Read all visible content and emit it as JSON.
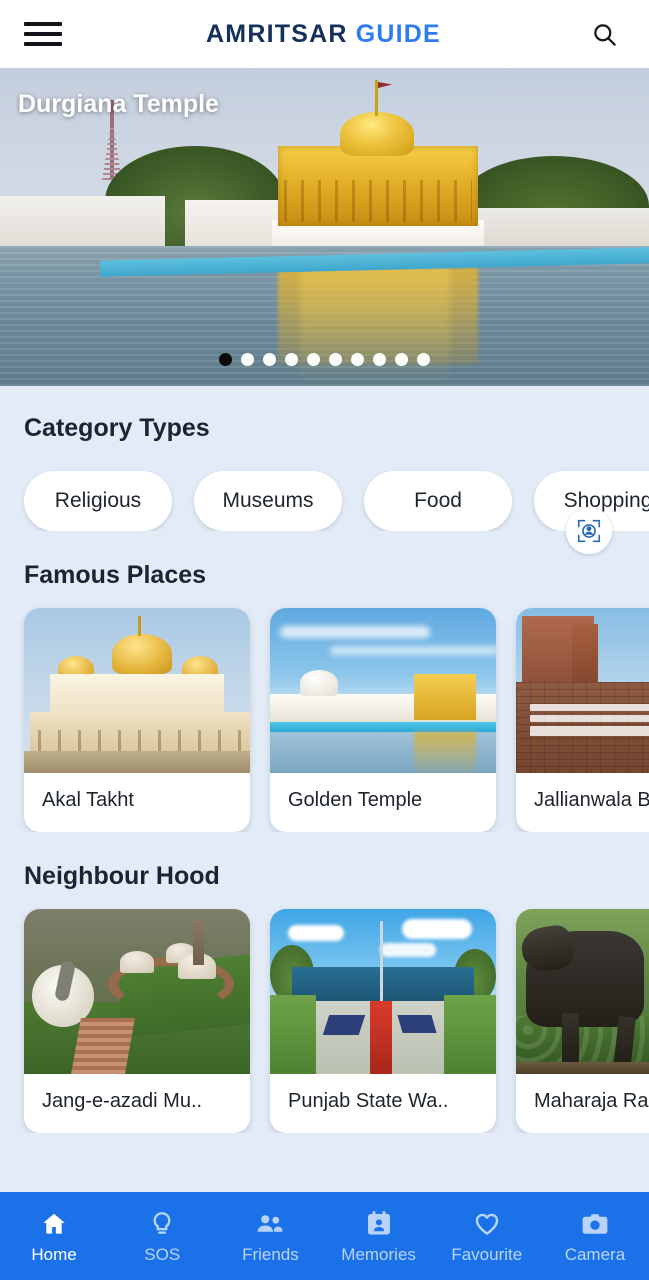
{
  "header": {
    "menu_icon": "hamburger-menu-icon",
    "brand_part1": "AMRITSAR",
    "brand_part2": "GUIDE",
    "search_icon": "search-icon"
  },
  "hero": {
    "title": "Durgiana Temple",
    "dot_count": 10,
    "active_dot_index": 0
  },
  "sections": {
    "category": {
      "title": "Category Types",
      "chips": [
        {
          "label": "Religious"
        },
        {
          "label": "Museums"
        },
        {
          "label": "Food"
        },
        {
          "label": "Shopping"
        }
      ],
      "floating_icon": "accessibility-person-frame-icon"
    },
    "famous": {
      "title": "Famous Places",
      "cards": [
        {
          "label": "Akal Takht",
          "art": "t-akal"
        },
        {
          "label": "Golden Temple",
          "art": "t-gold"
        },
        {
          "label": "Jallianwala Ba",
          "art": "t-jal"
        }
      ]
    },
    "neighbour": {
      "title": "Neighbour Hood",
      "cards": [
        {
          "label": "Jang-e-azadi Mu..",
          "art": "t-jang"
        },
        {
          "label": "Punjab State Wa..",
          "art": "t-pun"
        },
        {
          "label": "Maharaja Ran",
          "art": "t-mah"
        }
      ]
    }
  },
  "bottom_nav": {
    "items": [
      {
        "label": "Home",
        "icon": "home-icon",
        "active": true
      },
      {
        "label": "SOS",
        "icon": "lightbulb-icon",
        "active": false
      },
      {
        "label": "Friends",
        "icon": "people-icon",
        "active": false
      },
      {
        "label": "Memories",
        "icon": "contact-card-icon",
        "active": false
      },
      {
        "label": "Favourite",
        "icon": "heart-icon",
        "active": false
      },
      {
        "label": "Camera",
        "icon": "camera-icon",
        "active": false
      }
    ]
  },
  "colors": {
    "brand_dark": "#16305c",
    "brand_blue": "#2f7bf0",
    "nav_blue": "#1b72e8",
    "page_bg": "#e3ebf7",
    "card_bg": "#ffffff"
  }
}
